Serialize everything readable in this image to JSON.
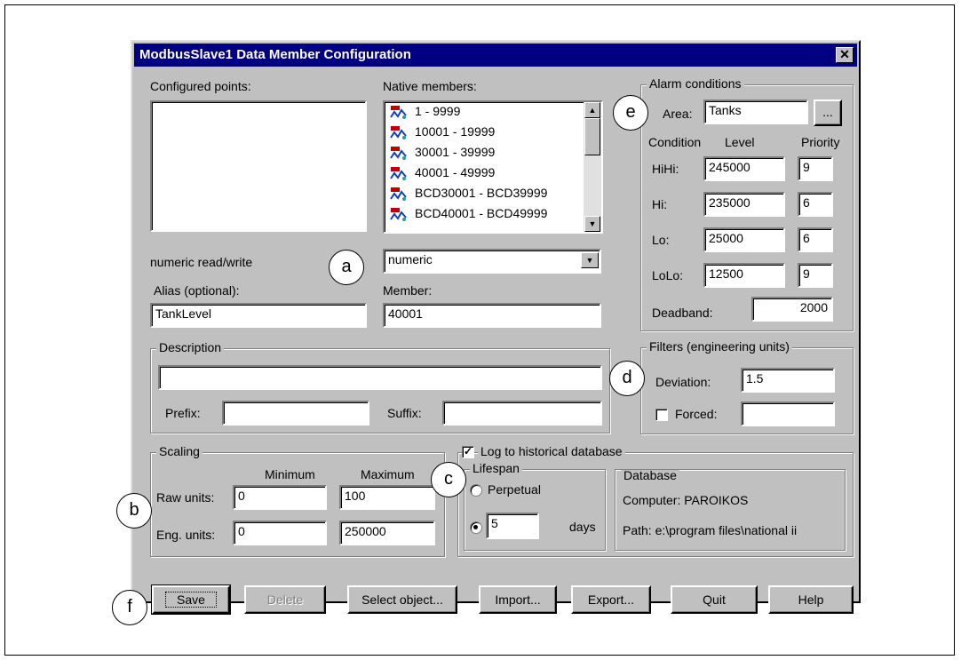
{
  "window": {
    "title": "ModbusSlave1 Data Member Configuration",
    "close_glyph": "✕"
  },
  "left": {
    "configured_label": "Configured points:",
    "configured_underline": "p",
    "mode_text": "numeric read/write",
    "alias_label": "Alias (optional):",
    "alias_value": "TankLevel"
  },
  "native": {
    "label": "Native members:",
    "items": [
      "1      - 9999",
      "10001    - 19999",
      "30001    - 39999",
      "40001    - 49999",
      "BCD30001 - BCD39999",
      "BCD40001 - BCD49999"
    ],
    "type_value": "numeric",
    "member_label": "Member:",
    "member_value": "40001"
  },
  "description": {
    "title": "Description",
    "value": "",
    "prefix_label": "Prefix:",
    "prefix_value": "",
    "suffix_label": "Suffix:",
    "suffix_value": ""
  },
  "alarm": {
    "title": "Alarm conditions",
    "area_label": "Area:",
    "area_value": "Tanks",
    "browse_label": "...",
    "headers": {
      "condition": "Condition",
      "level": "Level",
      "priority": "Priority"
    },
    "rows": [
      {
        "label": "HiHi:",
        "level": "245000",
        "priority": "9"
      },
      {
        "label": "Hi:",
        "level": "235000",
        "priority": "6"
      },
      {
        "label": "Lo:",
        "level": "25000",
        "priority": "6"
      },
      {
        "label": "LoLo:",
        "level": "12500",
        "priority": "9"
      }
    ],
    "deadband_label": "Deadband:",
    "deadband_value": "2000"
  },
  "filters": {
    "title": "Filters (engineering units)",
    "deviation_label": "Deviation:",
    "deviation_value": "1.5",
    "forced_label": "Forced:",
    "forced_value": ""
  },
  "scaling": {
    "title": "Scaling",
    "min_header": "Minimum",
    "max_header": "Maximum",
    "raw_label": "Raw units:",
    "raw_min": "0",
    "raw_max": "100",
    "eng_label": "Eng. units:",
    "eng_min": "0",
    "eng_max": "250000"
  },
  "historical": {
    "log_label": "Log to historical database",
    "log_checked": true,
    "lifespan_title": "Lifespan",
    "perpetual_label": "Perpetual",
    "days_value": "5",
    "days_label": "days",
    "database_title": "Database",
    "computer_text": "Computer: PAROIKOS",
    "path_text": "Path: e:\\program files\\national ii"
  },
  "buttons": {
    "save": "Save",
    "delete": "Delete",
    "select_object": "Select object...",
    "import": "Import...",
    "export": "Export...",
    "quit": "Quit",
    "help": "Help"
  },
  "callouts": {
    "a": "a",
    "b": "b",
    "c": "c",
    "d": "d",
    "e": "e",
    "f": "f"
  }
}
